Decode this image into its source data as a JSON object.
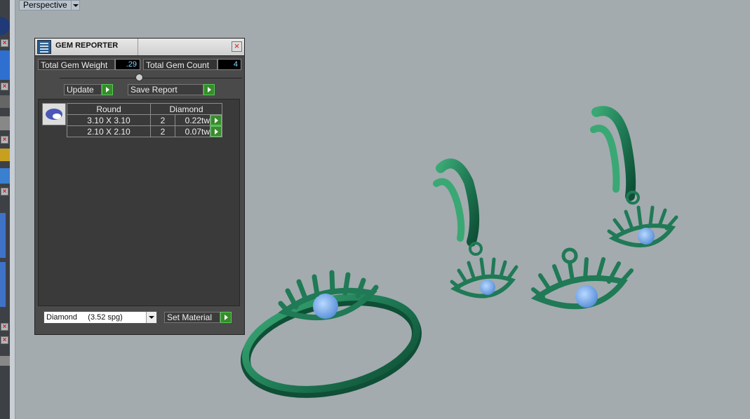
{
  "viewport": {
    "mode_label": "Perspective"
  },
  "gem_reporter": {
    "title": "GEM REPORTER",
    "total_gem_weight_label": "Total Gem Weight",
    "total_gem_weight_value": ".29",
    "total_gem_count_label": "Total Gem Count",
    "total_gem_count_value": "4",
    "update_label": "Update",
    "save_report_label": "Save Report",
    "table": {
      "headers": [
        "Round",
        "Diamond"
      ],
      "rows": [
        {
          "size": "3.10 X 3.10",
          "count": "2",
          "weight": "0.22tw"
        },
        {
          "size": "2.10 X 2.10",
          "count": "2",
          "weight": "0.07tw"
        }
      ]
    },
    "material_select_value": "Diamond     (3.52 spg)",
    "set_material_label": "Set Material"
  },
  "colors": {
    "metal": "#1f7a55",
    "metal_light": "#3aa874",
    "gem": "#6aa4e6",
    "background": "#a3abaf"
  }
}
